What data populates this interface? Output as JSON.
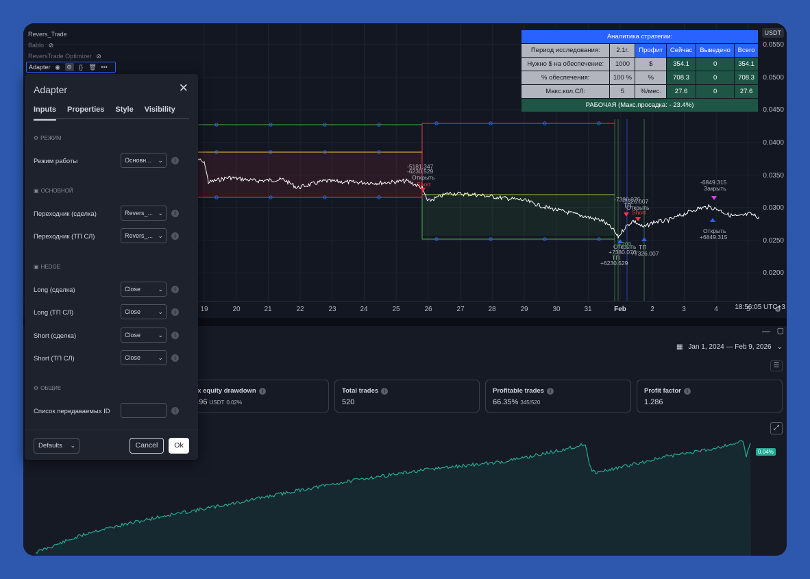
{
  "legend": [
    {
      "label": "Revers_Trade"
    },
    {
      "label": "Bablo"
    },
    {
      "label": "ReversTrade Optimizer"
    },
    {
      "label": "Adapter"
    }
  ],
  "price_scale": {
    "currency": "USDT",
    "ticks": [
      "0.0550",
      "0.0500",
      "0.0450",
      "0.0400",
      "0.0350",
      "0.0300",
      "0.0250",
      "0.0200"
    ]
  },
  "time_axis": {
    "ticks": [
      "19",
      "20",
      "21",
      "22",
      "23",
      "24",
      "25",
      "26",
      "27",
      "28",
      "29",
      "30",
      "31",
      "Feb",
      "2",
      "3",
      "4",
      "5"
    ],
    "clock": "18:56:05 UTC+3"
  },
  "strategy_table": {
    "title": "Аналитика стратегии:",
    "rows": [
      [
        "Период исследования:",
        "2.1г.",
        "Профит",
        "Сейчас",
        "Выведено",
        "Всего"
      ],
      [
        "Нужно $ на обеспечение:",
        "1000",
        "$",
        "354.1",
        "0",
        "354.1"
      ],
      [
        "% обеспечения:",
        "100 %",
        "%",
        "708.3",
        "0",
        "708.3"
      ],
      [
        "Макс.кол.СЛ:",
        "5",
        "%/мес.",
        "27.6",
        "0",
        "27.6"
      ]
    ],
    "footer": "РАБОЧАЯ (Макс.просадка: - 23.4%)"
  },
  "chart_labels": {
    "l1": "-5181.347",
    "l2": "-6230.529",
    "l3": "Открыть",
    "l4": "Short",
    "l5": "-7380.076",
    "l6": "-7326.007",
    "l7": "ТП",
    "l8": "Открыть",
    "l9": "Short",
    "l10": "-6849.315",
    "l11": "Закрыть",
    "l12": "Открыть",
    "l13": "+6849.315",
    "l14": "+200",
    "l15": "Открыть",
    "l16": "+7380.076",
    "l17": "ТП",
    "l18": "+6230.529",
    "l19": "ТП",
    "l20": "+7326.007"
  },
  "colors": {
    "up_line": "#4caf50",
    "down_line": "#f23645",
    "yellow_line": "#f5c242",
    "accent": "#2962ff",
    "equity": "#22ab94"
  },
  "bottom": {
    "date_range": "Jan 1, 2024 — Feb 9, 2026",
    "stats": [
      {
        "title": "Max equity drawdown",
        "value": "51.96",
        "unit": "USDT",
        "extra": "0.02%"
      },
      {
        "title": "Total trades",
        "value": "520",
        "unit": "",
        "extra": ""
      },
      {
        "title": "Profitable trades",
        "value": "66.35%",
        "unit": "",
        "extra": "345/520"
      },
      {
        "title": "Profit factor",
        "value": "1.286",
        "unit": "",
        "extra": ""
      }
    ],
    "equity_badge": "0.04%"
  },
  "dialog": {
    "title": "Adapter",
    "tabs": [
      "Inputs",
      "Properties",
      "Style",
      "Visibility"
    ],
    "sections": {
      "mode": "РЕЖИМ",
      "main": "ОСНОВНОЙ",
      "hedge": "HEDGE",
      "common": "ОБЩИЕ"
    },
    "rows": {
      "mode_label": "Режим работы",
      "mode_value": "Основн...",
      "adapter_deal_label": "Переходник (сделка)",
      "adapter_deal_value": "Revers_...",
      "adapter_tpsl_label": "Переходник (ТП СЛ)",
      "adapter_tpsl_value": "Revers_...",
      "long_deal_label": "Long (сделка)",
      "long_deal_value": "Close",
      "long_tpsl_label": "Long (ТП СЛ)",
      "long_tpsl_value": "Close",
      "short_deal_label": "Short (сделка)",
      "short_deal_value": "Close",
      "short_tpsl_label": "Short (ТП СЛ)",
      "short_tpsl_value": "Close",
      "ids_label": "Список передаваемых ID",
      "ids_value": ""
    },
    "footer": {
      "defaults": "Defaults",
      "cancel": "Cancel",
      "ok": "Ok"
    }
  }
}
